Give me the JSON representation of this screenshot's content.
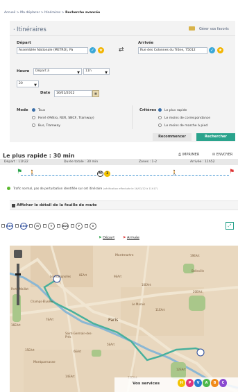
{
  "breadcrumb": {
    "prefix": "Accueil > Ma déplacer > Itinéraires > ",
    "current": "Recherche avancée"
  },
  "panel": {
    "title": "Itinéraires",
    "favorites_label": "Gérer vos favoris"
  },
  "departure": {
    "label": "Départ",
    "value": "Assemblée Nationale (METRO), Pa"
  },
  "arrival": {
    "label": "Arrivée",
    "value": "Rue des Colonnes du Trône, 75012"
  },
  "time": {
    "label": "Heure",
    "type_value": "Départ à",
    "hour_value": "11h",
    "minute_value": "20",
    "date_label": "Date",
    "date_value": "16/01/2012"
  },
  "mode": {
    "label": "Mode",
    "options": [
      "Tous",
      "Ferré (Métro, RER, SNCF, Tramway)",
      "Bus, Tramway"
    ]
  },
  "criteria": {
    "label": "Critères",
    "options": [
      "Le plus rapide",
      "Le moins de correspondance",
      "Le moins de marche à pied"
    ]
  },
  "buttons": {
    "reset": "Recommencer",
    "search": "Rechercher"
  },
  "result": {
    "title": "Le plus rapide : 30 min",
    "print": "IMPRIMER",
    "send": "ENVOYER",
    "departure": "Départ : 11h22",
    "duration": "Durée totale : 30 min",
    "zones": "Zones : 1-2",
    "arrival": "Arrivée : 11h52",
    "metro_line": "1",
    "traffic": "Trafic normal, pas de perturbation identifiée sur cet itinéraire",
    "traffic_note": "(vérification effectuée le 16/01/12 à 11h17)",
    "detail_link": "Afficher le détail de la feuille de route"
  },
  "map_filters": [
    "RER",
    "SNCF",
    "M",
    "T",
    "BUS",
    "P",
    "V"
  ],
  "map": {
    "legend_departure": "Départ",
    "legend_arrival": "Arrivée",
    "labels": [
      "Porte Maillot",
      "Les Batignolles",
      "Montmartre",
      "Belleville",
      "8EArt",
      "9EArt",
      "10EArt",
      "19EArt",
      "20EArt",
      "11EArt",
      "12EArt",
      "Le Marais",
      "Paris",
      "Saint-Germain-des-Prés",
      "Montparnasse",
      "15EArt",
      "6EArt",
      "5EArt",
      "14EArt",
      "13EArt",
      "16EArt",
      "7EArt",
      "Champs-Élysées"
    ]
  },
  "services": {
    "label": "Vos services",
    "items": [
      "H",
      "P",
      "V",
      "A",
      "B",
      "C"
    ]
  },
  "colors": {
    "accent_green": "#2aa38c",
    "route_blue": "#3a8fd0",
    "metro_yellow": "#f2c200",
    "ok_blue": "#3aa8d8",
    "star": "#f2b400"
  }
}
